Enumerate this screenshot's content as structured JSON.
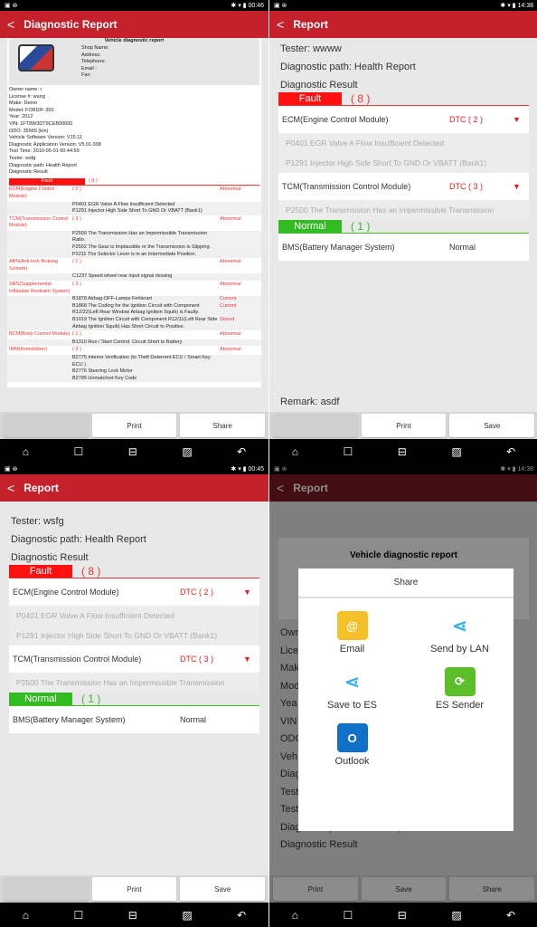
{
  "panels": [
    {
      "status": {
        "time": "00:46"
      },
      "title": "Diagnostic Report",
      "report": {
        "heading": "Vehicle diagnostic report",
        "shop_fields": [
          "Shop Name:",
          "Address:",
          "Telephone:",
          "Email :",
          "Fax:"
        ],
        "info": [
          "Owner name: r",
          "License #: wang",
          "Make: Demo",
          "Model: FORD/F-350",
          "Year: 2012",
          "VIN: 1FT8W3DT9CEB00000",
          "ODO: 35565 (km)",
          "Vehicle Software Version: V15.11",
          "Diagnostic Application Version: V5.01.008",
          "Test Time:  2010-05-01 00:44:59",
          "Tester: wsfg",
          "Diagnostic path: Health Report",
          "Diagnostic Result"
        ],
        "fault_label": "Fault",
        "fault_count": "( 8 )",
        "modules": [
          {
            "name": "ECM(Engine Control Module)",
            "count": "( 2 )",
            "status": "Abnormal",
            "dtcs": [
              {
                "text": "P0401 EGR Valve A Flow Insufficient Detected",
                "state": ""
              },
              {
                "text": "P1291 Injector High Side Short To GND Or VBATT (Bank1)",
                "state": ""
              }
            ]
          },
          {
            "name": "TCM(Transmission Control Module)",
            "count": "( 3 )",
            "status": "Abnormal",
            "dtcs": [
              {
                "text": "P2500 The Transmission Has an Impermissible Transmission Ratio.",
                "state": ""
              },
              {
                "text": "P2502 The Gear is Implausible or the Transmission is Slipping.",
                "state": ""
              },
              {
                "text": "P2211 The Selector Lever is in an Intermediate Position.",
                "state": ""
              }
            ]
          },
          {
            "name": "ABS(Anti-lock Braking System)",
            "count": "( 1 )",
            "status": "Abnormal",
            "dtcs": [
              {
                "text": "C1237 Speed wheel rear input signal missing",
                "state": ""
              }
            ]
          },
          {
            "name": "SRS(Supplemental Inflatable Restraint System)",
            "count": "( 3 )",
            "status": "Abnormal",
            "dtcs": [
              {
                "text": "B1878 Airbag-OFF-Lampe Fehlerart",
                "state": "Current"
              },
              {
                "text": "B1868 The Coding for the Ignition Circuit with Component R12/22(Left Rear Window Airbag Ignition Squib) is Faulty.",
                "state": "Current"
              },
              {
                "text": "B1019 The Ignition Circuit with Component R12/11(Left Rear Side Airbag Ignition Squib) Has Short Circuit to Positive.",
                "state": "Stored"
              }
            ]
          },
          {
            "name": "BCM(Body Control Module)",
            "count": "( 1 )",
            "status": "Abnormal",
            "dtcs": [
              {
                "text": "B1310 Run / Start Control: Circuit Short to Battery",
                "state": ""
              }
            ]
          },
          {
            "name": "IMM(Immobilizer)",
            "count": "( 3 )",
            "status": "Abnormal",
            "dtcs": [
              {
                "text": "B2775 Interior Verification (to Theft Deterrent ECU / Smart Key ECU )",
                "state": ""
              },
              {
                "text": "B2776 Steering Lock Motor",
                "state": ""
              },
              {
                "text": "B2795 Unmatched Key Code",
                "state": ""
              }
            ]
          }
        ]
      },
      "buttons": [
        "",
        "Print",
        "Share"
      ]
    },
    {
      "status": {
        "time": "14:38"
      },
      "title": "Report",
      "tester": "Tester: wwww",
      "path": "Diagnostic path: Health Report",
      "result": "Diagnostic Result",
      "fault_label": "Fault",
      "fault_count": "( 8 )",
      "ecm": {
        "name": "ECM(Engine Control Module)",
        "dtc": "DTC ( 2 )",
        "dtcs": [
          "P0401 EGR Valve A Flow Insufficient Detected",
          "P1291 Injector High Side Short To GND Or VBATT (Bank1)"
        ]
      },
      "tcm": {
        "name": "TCM(Transmission Control Module)",
        "dtc": "DTC ( 3 )",
        "dtcs": [
          "P2500 The Transmission Has an Impermissible Transmission"
        ]
      },
      "normal_label": "Normal",
      "normal_count": "( 1 )",
      "bms": {
        "name": "BMS(Battery Manager System)",
        "status": "Normal"
      },
      "remark": "Remark: asdf",
      "buttons": [
        "",
        "Print",
        "Save"
      ]
    },
    {
      "status": {
        "time": "00:45"
      },
      "title": "Report",
      "tester": "Tester: wsfg",
      "path": "Diagnostic path: Health Report",
      "result": "Diagnostic Result",
      "fault_label": "Fault",
      "fault_count": "( 8 )",
      "ecm": {
        "name": "ECM(Engine Control Module)",
        "dtc": "DTC ( 2 )",
        "dtcs": [
          "P0401 EGR Valve A Flow Insufficient Detected",
          "P1291 Injector High Side Short To GND Or VBATT (Bank1)"
        ]
      },
      "tcm": {
        "name": "TCM(Transmission Control Module)",
        "dtc": "DTC ( 3 )",
        "dtcs": [
          "P2500 The Transmission Has an Impermissible Transmission"
        ]
      },
      "normal_label": "Normal",
      "normal_count": "( 1 )",
      "bms": {
        "name": "BMS(Battery Manager System)",
        "status": "Normal"
      },
      "buttons": [
        "",
        "Print",
        "Save"
      ]
    },
    {
      "status": {
        "time": "14:38"
      },
      "title": "Report",
      "heading": "Vehicle diagnostic report",
      "shop_name": "Shop Name:",
      "bg_labels": [
        "Own",
        "Lice",
        "Mak",
        "Mod",
        "Yea",
        "VIN",
        "ODO",
        "Veh",
        "Diag",
        "Test"
      ],
      "tester": "Tester: wwww",
      "path": "Diagnostic path: Health Report",
      "result": "Diagnostic Result",
      "share": {
        "title": "Share",
        "apps": [
          {
            "label": "Email",
            "icon": "email-icon"
          },
          {
            "label": "Send by LAN",
            "icon": "share-lan-icon"
          },
          {
            "label": "Save to ES",
            "icon": "save-es-icon"
          },
          {
            "label": "ES Sender",
            "icon": "es-sender-icon"
          },
          {
            "label": "Outlook",
            "icon": "outlook-icon"
          }
        ]
      },
      "buttons": [
        "Print",
        "Save",
        "Share"
      ]
    }
  ],
  "colors": {
    "header": "#c4212d",
    "fault": "#ff1111",
    "normal": "#33bb22"
  }
}
